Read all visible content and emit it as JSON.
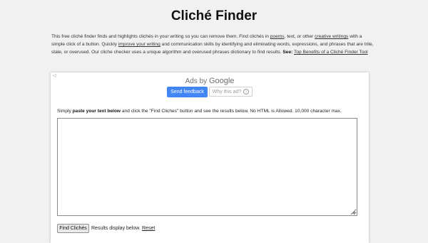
{
  "page": {
    "title": "Cliché Finder"
  },
  "intro": {
    "t1": "This free cliché finder finds and highlights clichés in your writing so you can remove them. Find clichés in ",
    "link_poems": "poems",
    "t2": ", text, or other ",
    "link_creative": "creative writings",
    "t3": " with a simple click of a button. Quickly ",
    "link_improve": "improve your writing",
    "t4": " and communication skills by identifying and eliminating words, expressions, and phrases that are trite, stale, or overused. Our cliche checker uses a unique algorithm and overused phrases dictionary to find results. ",
    "see_label": "See:",
    "link_top_benefits": "Top Benefits of a Cliché Finder Tool"
  },
  "ad": {
    "ads_by": "Ads by",
    "google": "Google",
    "send_feedback": "Send feedback",
    "why_this_ad": "Why this ad?",
    "info_glyph": "i",
    "adchoices_glyph": "◁",
    "accent_color": "#4285f4"
  },
  "instructions": {
    "t1": "Simply ",
    "bold": "paste your text below",
    "t2": " and click the \"Find Cliches\" button and see the results below. No HTML is Allowed. 10,000 character max."
  },
  "textarea": {
    "value": "",
    "resize_glyph": "◢"
  },
  "controls": {
    "find_button": "Find Clichés",
    "results_note": "Results display below.",
    "reset_link": "Reset"
  }
}
